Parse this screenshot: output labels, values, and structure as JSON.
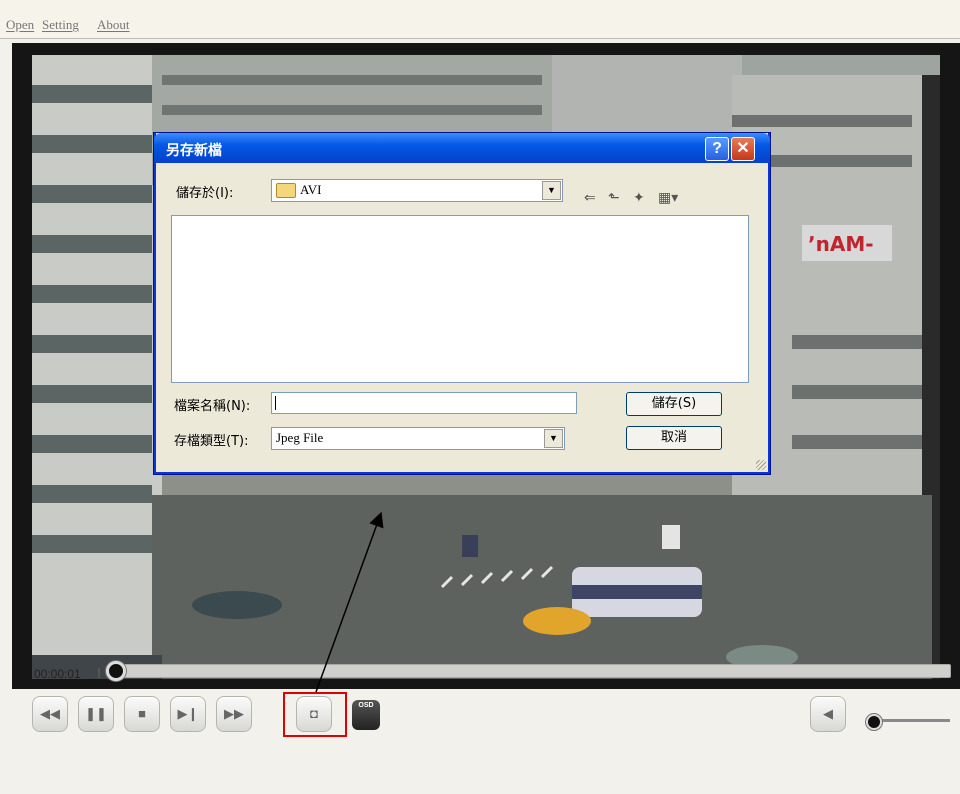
{
  "menu": {
    "open": "Open",
    "setting": "Setting",
    "about": "About"
  },
  "dialog": {
    "title": "另存新檔",
    "help": "?",
    "close": "✕",
    "save_in_label": "儲存於(I):",
    "save_in_value": "AVI",
    "filename_label": "檔案名稱(N):",
    "filename_value": "",
    "filetype_label": "存檔類型(T):",
    "filetype_value": "Jpeg File",
    "save_button": "儲存(S)",
    "cancel_button": "取消"
  },
  "player": {
    "time": "00:00:01",
    "seek_position": 0,
    "volume_level": 0,
    "osd_label": "OSD"
  },
  "icons": {
    "rewind": "rewind-icon",
    "pause": "pause-icon",
    "stop": "stop-icon",
    "step": "step-forward-icon",
    "fast_forward": "fast-forward-icon",
    "snapshot": "camera-icon",
    "osd": "osd-icon",
    "volume": "speaker-icon"
  },
  "colors": {
    "annotation": "#e00000",
    "dialog_title": "#0558e6"
  }
}
